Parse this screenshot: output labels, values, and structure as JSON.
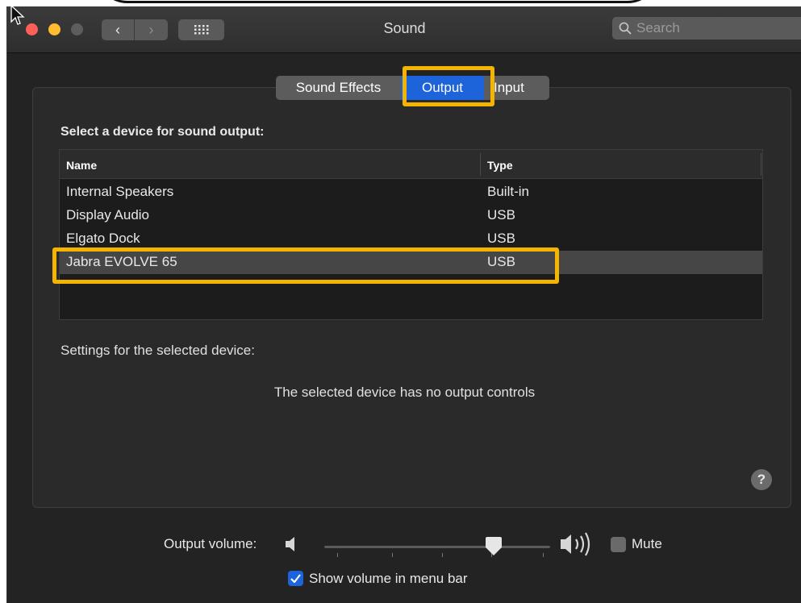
{
  "window": {
    "title": "Sound",
    "search_placeholder": "Search"
  },
  "tabs": [
    {
      "label": "Sound Effects",
      "selected": false
    },
    {
      "label": "Output",
      "selected": true
    },
    {
      "label": "Input",
      "selected": false
    }
  ],
  "output": {
    "section_title": "Select a device for sound output:",
    "columns": {
      "name": "Name",
      "type": "Type"
    },
    "devices": [
      {
        "name": "Internal Speakers",
        "type": "Built-in"
      },
      {
        "name": "Display Audio",
        "type": "USB"
      },
      {
        "name": "Elgato Dock",
        "type": "USB"
      },
      {
        "name": "Jabra EVOLVE 65",
        "type": "USB",
        "selected": true
      }
    ],
    "settings_label": "Settings for the selected device:",
    "no_controls_message": "The selected device has no output controls"
  },
  "help": {
    "label": "?"
  },
  "volume": {
    "label": "Output volume:",
    "level": 0.75,
    "mute_label": "Mute",
    "muted": false
  },
  "menubar": {
    "label": "Show volume in menu bar",
    "checked": true
  },
  "colors": {
    "accent": "#1d63d9",
    "highlight": "#f5b400",
    "close": "#fe5f57",
    "minimize": "#febc2e"
  }
}
